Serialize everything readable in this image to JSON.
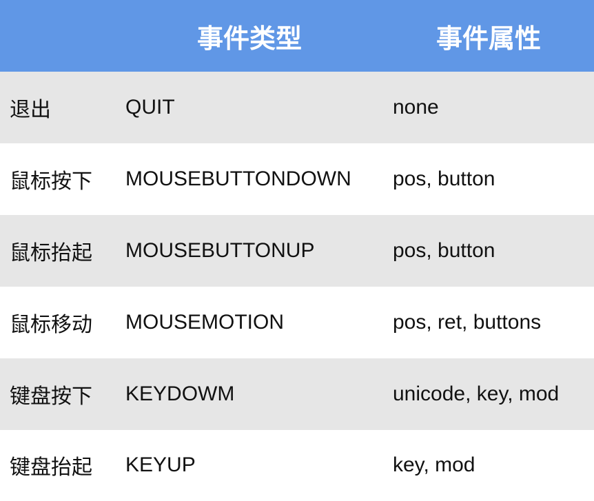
{
  "header": {
    "col1": "",
    "col2": "事件类型",
    "col3": "事件属性"
  },
  "colors": {
    "header_bg": "#6097e6",
    "row_shaded": "#e6e6e6",
    "row_plain": "#ffffff"
  },
  "rows": [
    {
      "name": "退出",
      "type": "QUIT",
      "attrs": "none"
    },
    {
      "name": "鼠标按下",
      "type": "MOUSEBUTTONDOWN",
      "attrs": "pos, button"
    },
    {
      "name": "鼠标抬起",
      "type": "MOUSEBUTTONUP",
      "attrs": "pos, button"
    },
    {
      "name": "鼠标移动",
      "type": "MOUSEMOTION",
      "attrs": "pos, ret, buttons"
    },
    {
      "name": "键盘按下",
      "type": "KEYDOWM",
      "attrs": "unicode, key, mod"
    },
    {
      "name": "键盘抬起",
      "type": "KEYUP",
      "attrs": "key, mod"
    }
  ]
}
